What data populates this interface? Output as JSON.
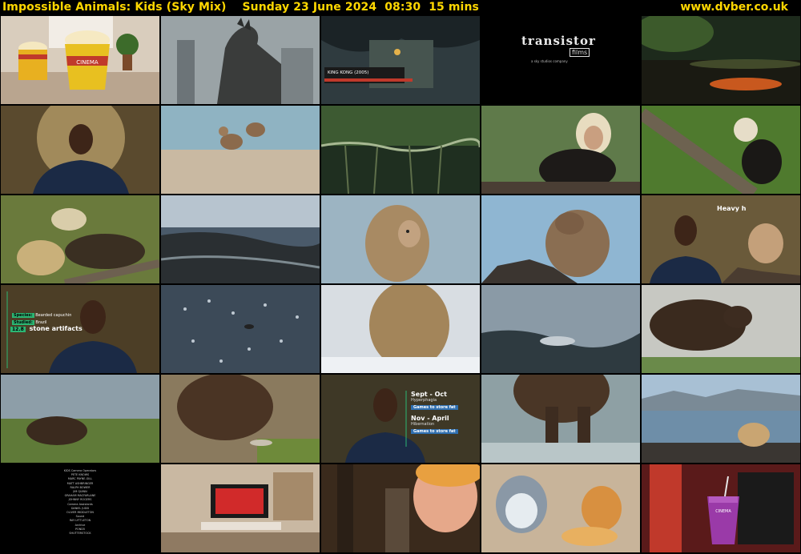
{
  "header": {
    "title": "Impossible Animals: Kids (Sky Mix)    Sunday 23 June 2024  08:30  15 mins",
    "site": "www.dvber.co.uk"
  },
  "colors": {
    "header_text": "#ffd700",
    "background": "#000000",
    "accent_green": "#2bb673"
  },
  "thumbnails": [
    {
      "scene": "popcorn buckets on table",
      "text": "CINEMA"
    },
    {
      "scene": "kaiju monster in city"
    },
    {
      "scene": "cave scene with banner",
      "text": "KING KONG (2005)"
    },
    {
      "scene": "studio logo",
      "text": "transistor",
      "text2": "films",
      "text3": "a sky studios company"
    },
    {
      "scene": "jungle pond"
    },
    {
      "scene": "presenter in black polo"
    },
    {
      "scene": "monkeys on beach"
    },
    {
      "scene": "mangrove roots"
    },
    {
      "scene": "capuchin with stone"
    },
    {
      "scene": "capuchin on branch"
    },
    {
      "scene": "capuchins cracking nuts"
    },
    {
      "scene": "rocky shoreline"
    },
    {
      "scene": "macaque profile"
    },
    {
      "scene": "macaque on rocks"
    },
    {
      "scene": "presenter with macaque",
      "text": "Heavy h"
    },
    {
      "scene": "presenter with species card",
      "species_label": "Species:",
      "species_value": "Bearded capuchin",
      "location_label": "Studied:",
      "location_value": "Brazil",
      "badge": "12.8",
      "caption": "stone artifacts"
    },
    {
      "scene": "glittering water"
    },
    {
      "scene": "macaque in snow"
    },
    {
      "scene": "salmon in river"
    },
    {
      "scene": "bear running in water"
    },
    {
      "scene": "bear in grass"
    },
    {
      "scene": "bear eating fish"
    },
    {
      "scene": "presenter with seasons",
      "s1": "Sept - Oct",
      "s1sub": "Hyperphagia",
      "s1tag": "Games to store fat",
      "s2": "Nov - April",
      "s2sub": "Hibernation",
      "s2tag": "Games to store fat"
    },
    {
      "scene": "bear legs in river"
    },
    {
      "scene": "raccoon on shore"
    },
    {
      "scene": "end credits"
    },
    {
      "scene": "living room with tv"
    },
    {
      "scene": "animated character"
    },
    {
      "scene": "animated hamster and squirrel"
    },
    {
      "scene": "cinema cup",
      "text": "CINEMA"
    }
  ],
  "credits": [
    "KIDS Camera Operators",
    "PETE KNOWS",
    "MARC PAYNE-GILL",
    "MATT ASHBRINGER",
    "RALPH BOWER",
    "JIM QUINN",
    "GRAHAM MACFARLANE",
    "JOHNNY ROGERS",
    "",
    "Camera Assistants",
    "DANIEL JUDD",
    "OLIVER MIDDLETON",
    "",
    "Sound",
    "RAY LYTTLETON",
    "",
    "Archive",
    "POND5",
    "SHUTTERSTOCK"
  ]
}
